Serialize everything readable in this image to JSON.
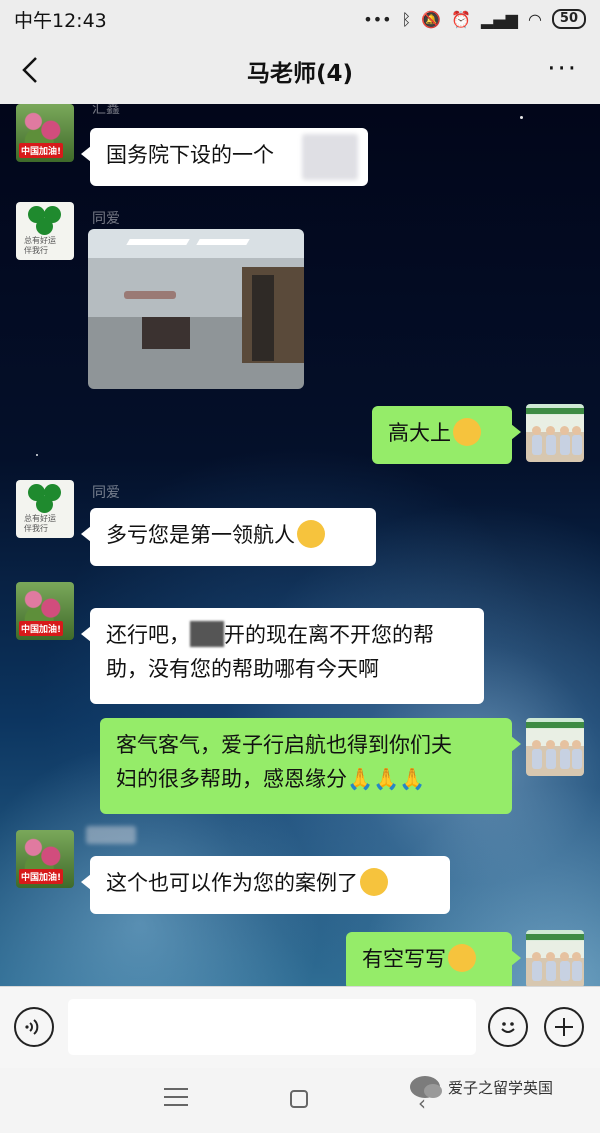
{
  "status_bar": {
    "time": "中午12:43",
    "battery": "50"
  },
  "header": {
    "title": "马老师(4)"
  },
  "messages": [
    {
      "side": "left",
      "sender": "汇鑫",
      "text": "国务院下设的一个"
    },
    {
      "side": "left",
      "sender": "同爱",
      "type": "image"
    },
    {
      "side": "right",
      "text": "高大上"
    },
    {
      "side": "left",
      "sender": "同爱",
      "text": "多亏您是第一领航人"
    },
    {
      "side": "left",
      "line1_a": "还行吧，",
      "line1_b": "开的现在离不开您的帮",
      "line2": "助，没有您的帮助哪有今天啊"
    },
    {
      "side": "right",
      "line1": "客气客气，爱子行启航也得到你们夫",
      "line2": "妇的很多帮助，感恩缘分",
      "emoji": "🙏🙏🙏"
    },
    {
      "side": "left",
      "text": "这个也可以作为您的案例了"
    },
    {
      "side": "right",
      "text": "有空写写"
    }
  ],
  "avatars": {
    "flowers_tag": "中国加油!",
    "clover_text": "总有好运\n伴我行"
  },
  "watermark": {
    "text": "爱子之留学英国"
  },
  "colors": {
    "bubble_self": "#95ec69",
    "bubble_other": "#ffffff",
    "bar_bg": "#ededed"
  }
}
